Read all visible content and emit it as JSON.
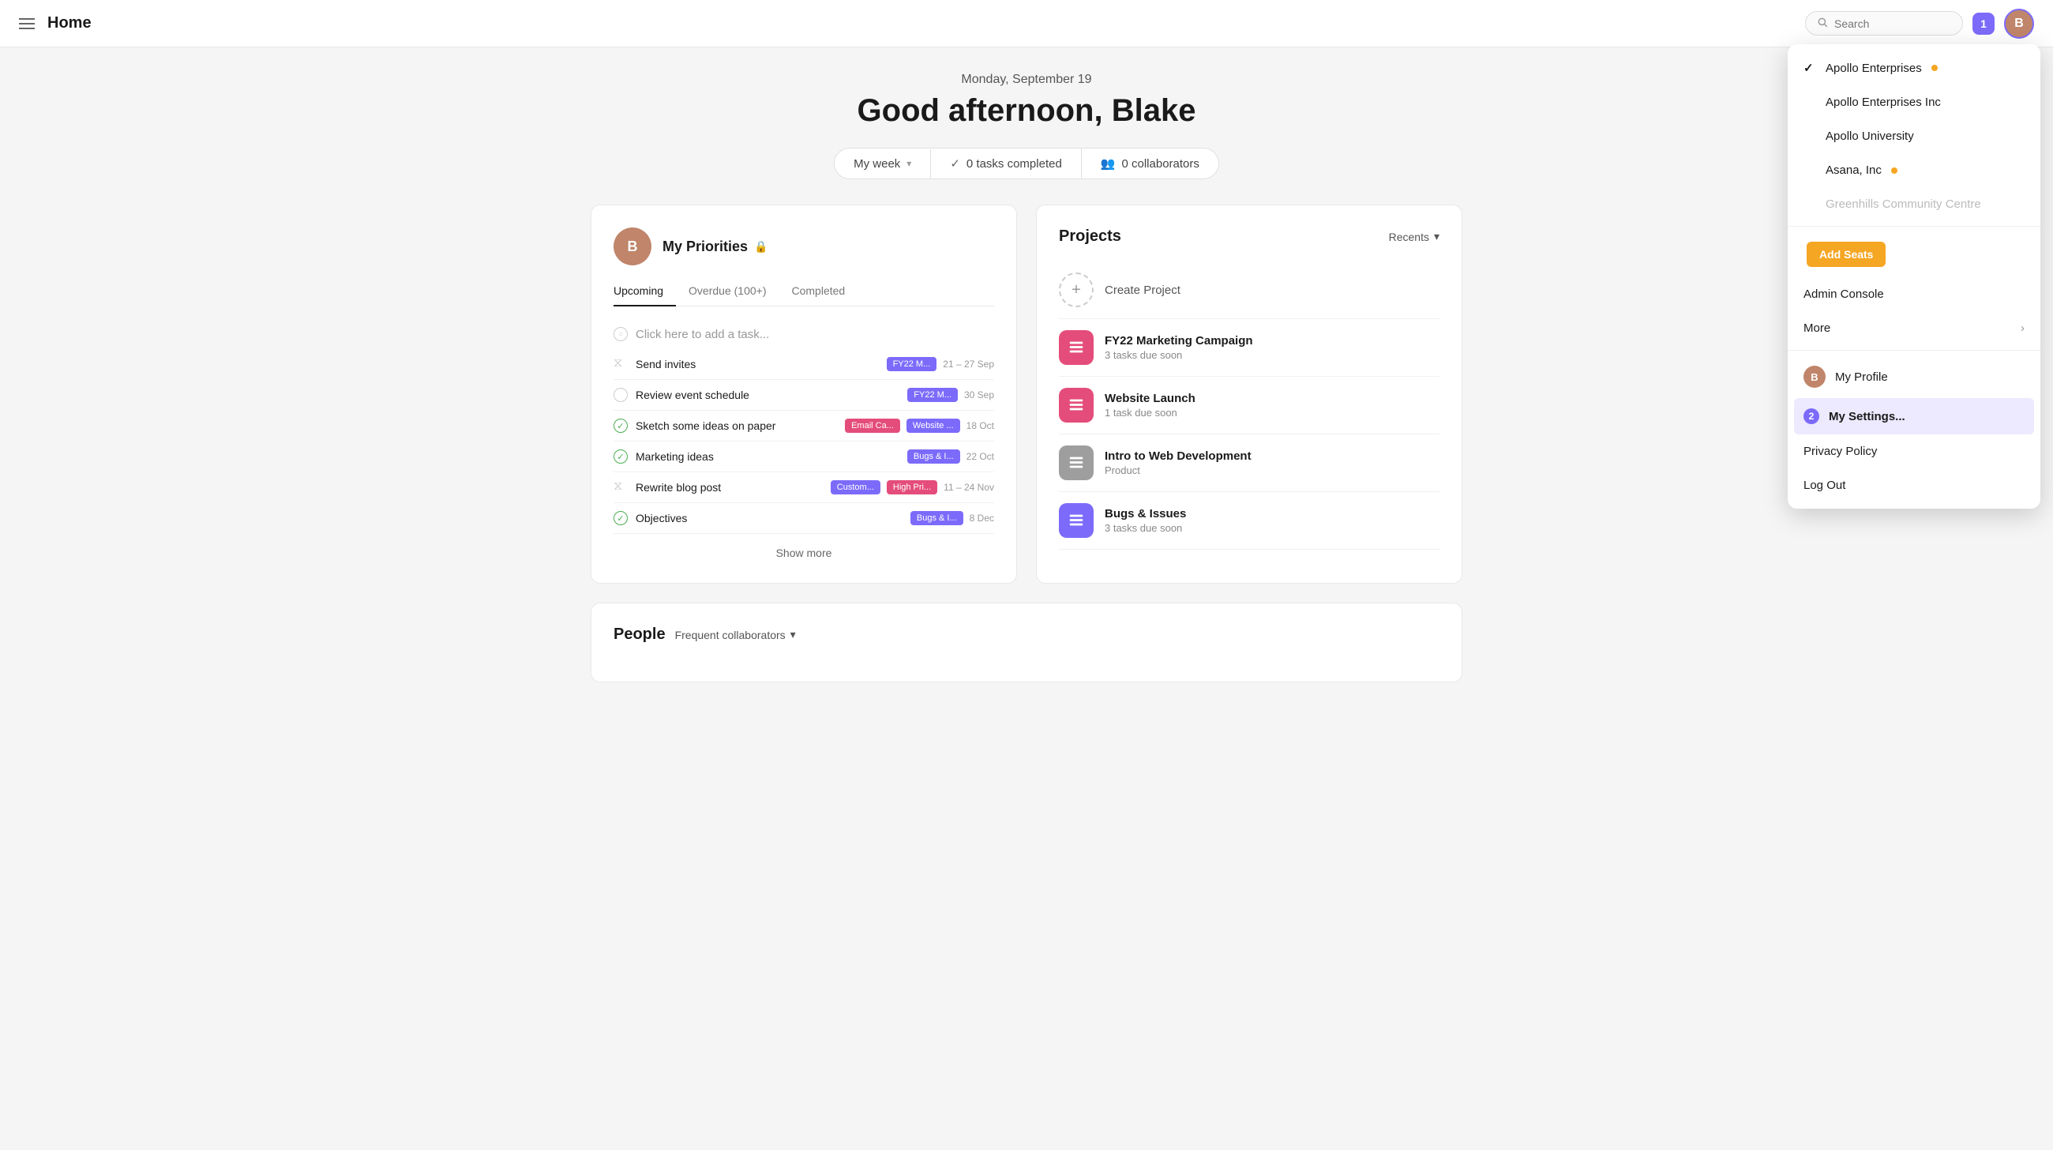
{
  "topbar": {
    "title": "Home",
    "search_placeholder": "Search",
    "notif_count": "1"
  },
  "hero": {
    "date": "Monday, September 19",
    "greeting": "Good afternoon, Blake",
    "my_week_label": "My week",
    "tasks_completed": "0 tasks completed",
    "collaborators": "0 collaborators"
  },
  "priorities": {
    "title": "My Priorities",
    "tab_upcoming": "Upcoming",
    "tab_overdue": "Overdue (100+)",
    "tab_completed": "Completed",
    "add_task_placeholder": "Click here to add a task...",
    "tasks": [
      {
        "name": "Send invites",
        "icon": "hourglass",
        "tags": [
          "FY22 M..."
        ],
        "tag_colors": [
          "purple"
        ],
        "date": "21 – 27 Sep"
      },
      {
        "name": "Review event schedule",
        "icon": "circle",
        "tags": [
          "FY22 M..."
        ],
        "tag_colors": [
          "purple"
        ],
        "date": "30 Sep"
      },
      {
        "name": "Sketch some ideas on paper",
        "icon": "circle-done",
        "tags": [
          "Email Ca...",
          "Website ..."
        ],
        "tag_colors": [
          "pink",
          "purple"
        ],
        "date": "18 Oct"
      },
      {
        "name": "Marketing ideas",
        "icon": "circle-done",
        "tags": [
          "Bugs & I..."
        ],
        "tag_colors": [
          "purple"
        ],
        "date": "22 Oct"
      },
      {
        "name": "Rewrite blog post",
        "icon": "hourglass",
        "tags": [
          "Custom...",
          "High Pri..."
        ],
        "tag_colors": [
          "purple",
          "pink"
        ],
        "date": "11 – 24 Nov"
      },
      {
        "name": "Objectives",
        "icon": "circle-done",
        "tags": [
          "Bugs & I..."
        ],
        "tag_colors": [
          "purple"
        ],
        "date": "8 Dec"
      }
    ],
    "show_more_label": "Show more"
  },
  "projects": {
    "title": "Projects",
    "recents_label": "Recents",
    "create_label": "Create Project",
    "items": [
      {
        "name": "FY22 Marketing Campaign",
        "sub": "3 tasks due soon",
        "color": "pink"
      },
      {
        "name": "Website Launch",
        "sub": "1 task due soon",
        "color": "pink"
      },
      {
        "name": "Intro to Web Development",
        "sub": "Product",
        "color": "gray"
      },
      {
        "name": "Bugs & Issues",
        "sub": "3 tasks due soon",
        "color": "purple"
      }
    ]
  },
  "people": {
    "title": "People",
    "frequent_collaborators_label": "Frequent collaborators"
  },
  "dropdown": {
    "items": [
      {
        "type": "org",
        "name": "Apollo Enterprises",
        "dot": "orange",
        "checked": true
      },
      {
        "type": "org",
        "name": "Apollo Enterprises Inc",
        "dot": null,
        "checked": false
      },
      {
        "type": "org",
        "name": "Apollo University",
        "dot": null,
        "checked": false
      },
      {
        "type": "org",
        "name": "Asana, Inc",
        "dot": "orange",
        "checked": false
      },
      {
        "type": "org",
        "name": "Greenhills Community Centre",
        "dot": null,
        "checked": false,
        "greyed": true
      }
    ],
    "add_seats_label": "Add Seats",
    "admin_console_label": "Admin Console",
    "more_label": "More",
    "my_profile_label": "My Profile",
    "my_settings_label": "My Settings...",
    "privacy_policy_label": "Privacy Policy",
    "log_out_label": "Log Out"
  }
}
